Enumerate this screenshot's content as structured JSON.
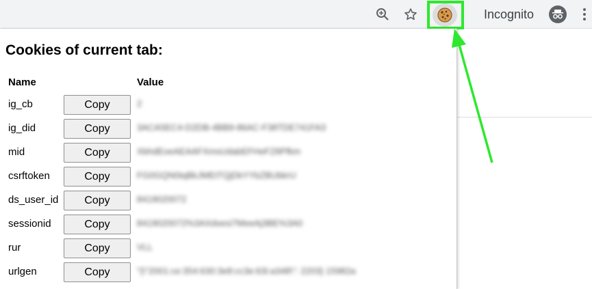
{
  "toolbar": {
    "incognito_label": "Incognito",
    "icons": [
      "zoom-icon",
      "star-icon",
      "cookie-extension-icon",
      "incognito-icon",
      "menu-icon"
    ]
  },
  "popup": {
    "title": "Cookies of current tab:",
    "columns": {
      "name": "Name",
      "value": "Value"
    },
    "copy_label": "Copy",
    "rows": [
      {
        "name": "ig_cb",
        "value": "2"
      },
      {
        "name": "ig_did",
        "value": "3ACA5EC4-D2DB-4BB9-86AC-F38TDE741FA3"
      },
      {
        "name": "mid",
        "value": "XbhdEoeAEAAFXmsUdabEFHeFZ8Pfkm"
      },
      {
        "name": "csrftoken",
        "value": "FG0GQN0tqBkJMEtTQjDkYYbZBUbkrU"
      },
      {
        "name": "ds_user_id",
        "value": "8419020072"
      },
      {
        "name": "sessionid",
        "value": "8419020072%3AXdsesi7MeeAj3BE%3A0"
      },
      {
        "name": "rur",
        "value": "VLL"
      },
      {
        "name": "urlgen",
        "value": "\"{\\\"2001:ce:354:630:3e8:cc3e:63i:a348\\\": 2203} 15982a"
      }
    ]
  },
  "colors": {
    "highlight": "#2ee82e",
    "toolbar_bg": "#f1f3f4"
  }
}
